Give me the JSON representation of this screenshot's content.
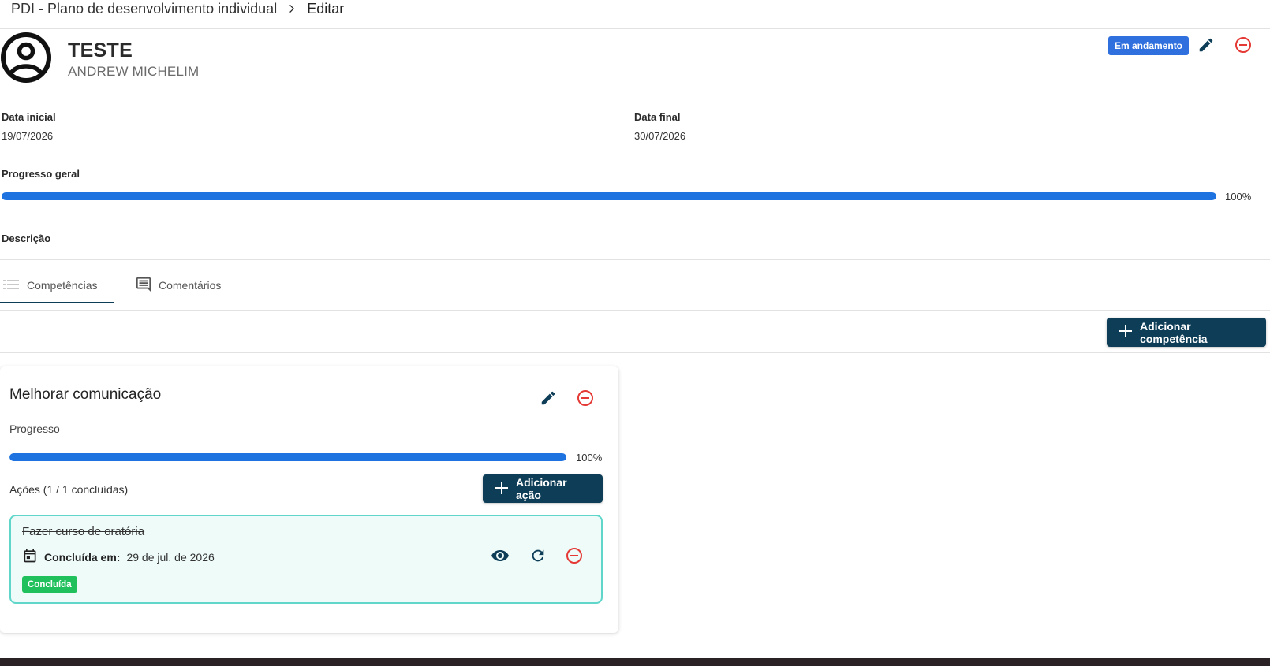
{
  "breadcrumb": {
    "parent": "PDI - Plano de desenvolvimento individual",
    "current": "Editar"
  },
  "header": {
    "title": "TESTE",
    "subtitle": "ANDREW MICHELIM",
    "status": "Em andamento"
  },
  "fields": {
    "start_label": "Data inicial",
    "start_value": "19/07/2026",
    "end_label": "Data final",
    "end_value": "30/07/2026",
    "progress_label": "Progresso geral",
    "progress_percent_text": "100%",
    "progress_value": 1.0,
    "description_label": "Descrição"
  },
  "tabs": [
    {
      "label": "Competências",
      "icon": "list-icon",
      "active": true
    },
    {
      "label": "Comentários",
      "icon": "comment-icon",
      "active": false
    }
  ],
  "add_competence_label": "Adicionar competência",
  "competence": {
    "title": "Melhorar comunicação",
    "progress_label": "Progresso",
    "progress_percent_text": "100%",
    "progress_value": 1.0,
    "actions_count": "Ações (1 / 1 concluídas)",
    "add_action_label": "Adicionar ação",
    "action": {
      "title": "Fazer curso de oratória",
      "date_label": "Concluída em:",
      "date_value": "29 de jul. de 2026",
      "badge": "Concluída"
    }
  },
  "colors": {
    "primary": "#0d3d57",
    "status": "#2f6fde",
    "progress": "#1f73e0",
    "danger": "#e53935",
    "success": "#20c05c",
    "action_border": "#5fd6c9"
  }
}
